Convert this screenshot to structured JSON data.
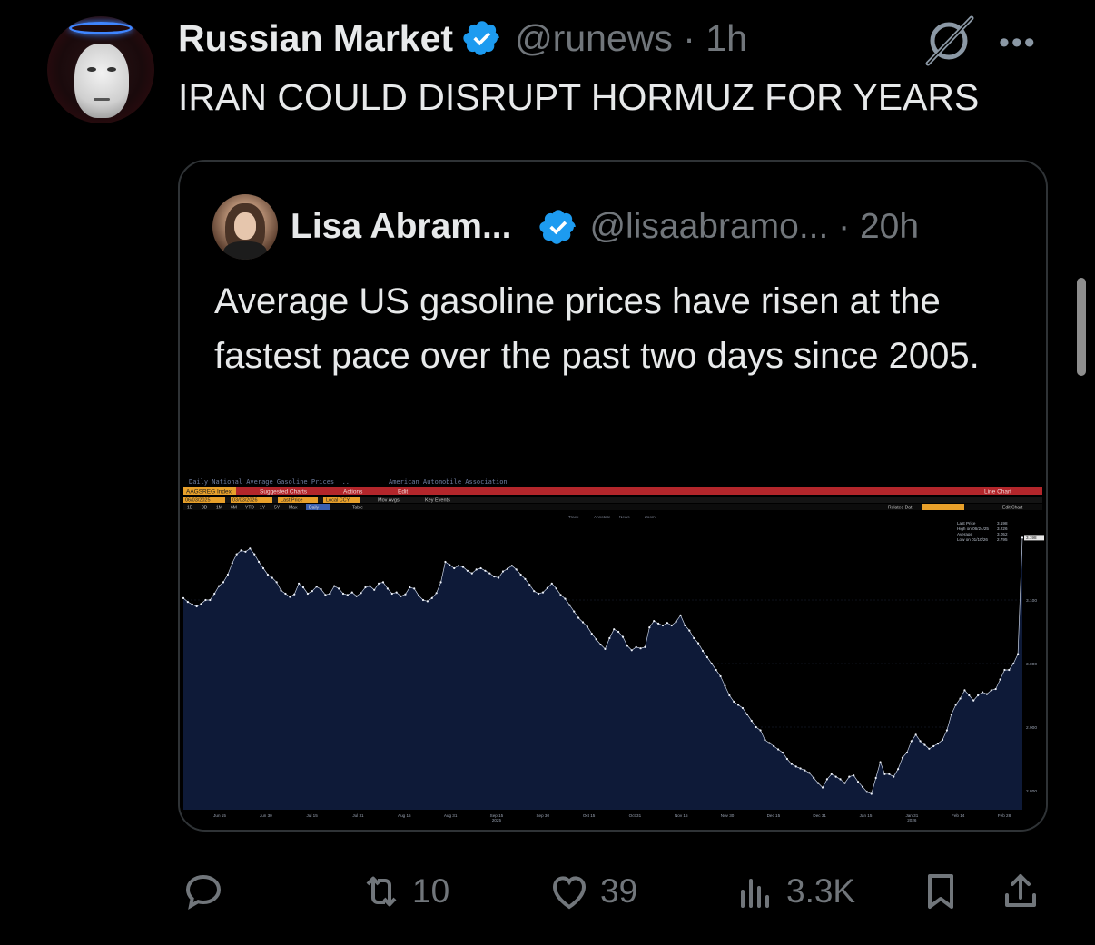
{
  "post": {
    "author_name": "Russian Market",
    "handle_time": "@runews · 1h",
    "text": "IRAN COULD DISRUPT HORMUZ FOR YEARS"
  },
  "quoted": {
    "author_name": "Lisa Abram...",
    "handle_time": "@lisaabramo... · 20h",
    "text": "Average US gasoline prices have risen at the fastest pace over the past two days since 2005."
  },
  "terminal": {
    "title": "Daily National Average Gasoline Prices ...",
    "source": "American Automobile Association",
    "ticker": "AAGSREG Index",
    "menu_suggested": "Suggested Charts",
    "menu_actions": "Actions",
    "menu_edit": "Edit",
    "line_chart": "Line Chart",
    "date_start": "06/03/2025",
    "date_end": "03/03/2026",
    "field_last_price": "Last Price",
    "field_local_ccy": "Local CCY",
    "mov_avgs": "Mov Avgs",
    "key_events": "Key Events",
    "ranges": [
      "1D",
      "3D",
      "1M",
      "6M",
      "YTD",
      "1Y",
      "5Y",
      "Max"
    ],
    "daily": "Daily",
    "table": "Table",
    "related": "Related Dat",
    "edit_chart": "Edit Chart",
    "tools": [
      "Track",
      "Annotate",
      "News",
      "Zoom"
    ],
    "legend_last_price": "Last Price",
    "legend_high": "High on 06/24/25",
    "legend_average": "Average",
    "legend_low": "Low on 01/10/26"
  },
  "chart_data": {
    "type": "area",
    "x_labels": [
      "Jun 15",
      "Jun 30",
      "Jul 15",
      "Jul 31",
      "Aug 15",
      "Aug 31",
      "Sep 15\n2025",
      "Sep 30",
      "Oct 15",
      "Oct 31",
      "Nov 15",
      "Nov 30",
      "Dec 15",
      "Dec 31",
      "Jan 15",
      "Jan 31\n2026",
      "Feb 14",
      "Feb 28"
    ],
    "y_ticks": [
      2.8,
      2.9,
      3.0,
      3.1
    ],
    "ylim": [
      2.77,
      3.23
    ],
    "last_price": 3.198,
    "high": 3.226,
    "average": 3.052,
    "low": 2.795,
    "series": [
      {
        "values": [
          3.103,
          3.097,
          3.093,
          3.09,
          3.094,
          3.1,
          3.1,
          3.11,
          3.122,
          3.128,
          3.14,
          3.158,
          3.172,
          3.178,
          3.176,
          3.181,
          3.172,
          3.16,
          3.15,
          3.14,
          3.135,
          3.128,
          3.115,
          3.11,
          3.105,
          3.109,
          3.126,
          3.12,
          3.11,
          3.114,
          3.121,
          3.117,
          3.108,
          3.11,
          3.122,
          3.118,
          3.11,
          3.108,
          3.112,
          3.106,
          3.111,
          3.12,
          3.122,
          3.116,
          3.126,
          3.128,
          3.118,
          3.11,
          3.112,
          3.106,
          3.109,
          3.12,
          3.118,
          3.107,
          3.1,
          3.098,
          3.103,
          3.111,
          3.128,
          3.16,
          3.155,
          3.15,
          3.154,
          3.152,
          3.146,
          3.142,
          3.148,
          3.15,
          3.146,
          3.142,
          3.137,
          3.135,
          3.145,
          3.149,
          3.154,
          3.148,
          3.14,
          3.133,
          3.124,
          3.114,
          3.11,
          3.112,
          3.119,
          3.126,
          3.118,
          3.108,
          3.102,
          3.092,
          3.082,
          3.072,
          3.065,
          3.058,
          3.047,
          3.038,
          3.03,
          3.023,
          3.04,
          3.054,
          3.05,
          3.042,
          3.028,
          3.021,
          3.026,
          3.024,
          3.026,
          3.057,
          3.067,
          3.063,
          3.06,
          3.064,
          3.06,
          3.066,
          3.076,
          3.06,
          3.052,
          3.04,
          3.032,
          3.02,
          3.01,
          3.0,
          2.99,
          2.98,
          2.965,
          2.95,
          2.94,
          2.935,
          2.93,
          2.92,
          2.91,
          2.9,
          2.895,
          2.88,
          2.875,
          2.87,
          2.865,
          2.86,
          2.85,
          2.842,
          2.838,
          2.835,
          2.832,
          2.828,
          2.82,
          2.812,
          2.805,
          2.818,
          2.826,
          2.822,
          2.818,
          2.812,
          2.822,
          2.824,
          2.814,
          2.806,
          2.798,
          2.795,
          2.82,
          2.845,
          2.826,
          2.826,
          2.822,
          2.834,
          2.852,
          2.86,
          2.878,
          2.888,
          2.878,
          2.872,
          2.866,
          2.87,
          2.874,
          2.88,
          2.895,
          2.92,
          2.935,
          2.945,
          2.958,
          2.95,
          2.942,
          2.95,
          2.955,
          2.952,
          2.958,
          2.96,
          2.975,
          2.99,
          2.99,
          3.0,
          3.015,
          3.198
        ]
      }
    ]
  },
  "actions": {
    "replies": "",
    "reposts": "10",
    "likes": "39",
    "views": "3.3K"
  }
}
